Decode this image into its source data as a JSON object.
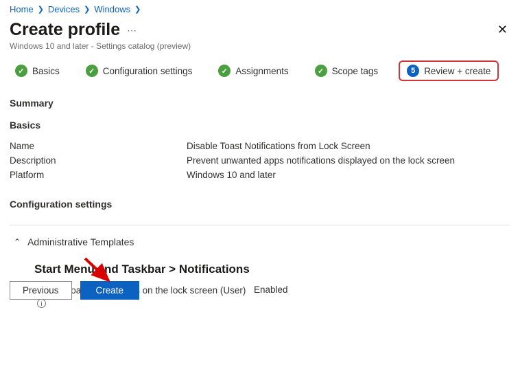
{
  "breadcrumb": [
    "Home",
    "Devices",
    "Windows"
  ],
  "header": {
    "title": "Create profile",
    "subtitle": "Windows 10 and later - Settings catalog (preview)"
  },
  "stepper": {
    "steps": [
      {
        "label": "Basics",
        "state": "done"
      },
      {
        "label": "Configuration settings",
        "state": "done"
      },
      {
        "label": "Assignments",
        "state": "done"
      },
      {
        "label": "Scope tags",
        "state": "done"
      },
      {
        "label": "Review + create",
        "state": "active",
        "number": "5"
      }
    ]
  },
  "summary": {
    "heading": "Summary",
    "basics_heading": "Basics",
    "rows": [
      {
        "k": "Name",
        "v": "Disable Toast Notifications from Lock Screen"
      },
      {
        "k": "Description",
        "v": "Prevent unwanted apps notifications displayed on the lock screen"
      },
      {
        "k": "Platform",
        "v": "Windows 10 and later"
      }
    ]
  },
  "config": {
    "heading": "Configuration settings",
    "expander": "Administrative Templates",
    "subcat": "Start Menu and Taskbar > Notifications",
    "setting_label": "Turn off toast notifications on the lock screen (User)",
    "setting_value": "Enabled"
  },
  "footer": {
    "previous": "Previous",
    "create": "Create"
  }
}
